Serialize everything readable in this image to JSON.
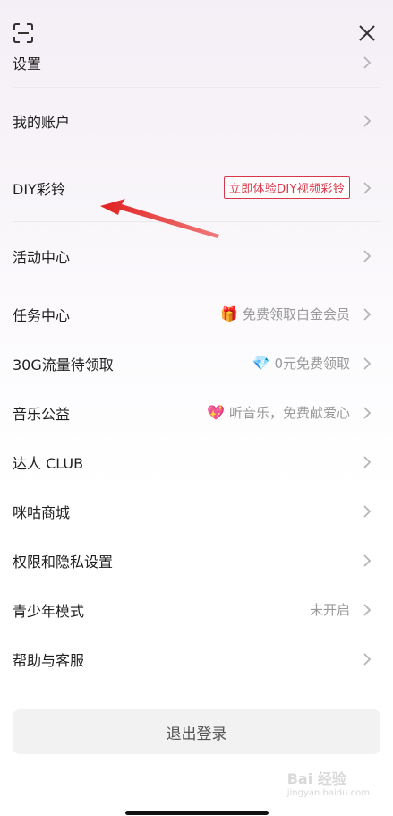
{
  "menu": {
    "settings": "设置",
    "my_account": "我的账户",
    "diy_ringtone": "DIY彩铃",
    "diy_badge": "立即体验DIY视频彩铃",
    "activity_center": "活动中心",
    "task_center": "任务中心",
    "task_hint": "免费领取白金会员",
    "traffic": "30G流量待领取",
    "traffic_hint": "0元免费领取",
    "music_charity": "音乐公益",
    "charity_hint": "听音乐，免费献爱心",
    "talent_club": "达人 CLUB",
    "migu_mall": "咪咕商城",
    "privacy": "权限和隐私设置",
    "teen_mode": "青少年模式",
    "teen_status": "未开启",
    "help": "帮助与客服"
  },
  "logout_label": "退出登录",
  "watermark": {
    "brand": "Bai 经验",
    "sub": "jingyan.baidu.com"
  },
  "icons": {
    "task": "gift-icon",
    "traffic": "diamond-icon",
    "charity": "heart-icon"
  },
  "colors": {
    "badge_red": "#d9374a",
    "annotation_red": "#e02020"
  }
}
